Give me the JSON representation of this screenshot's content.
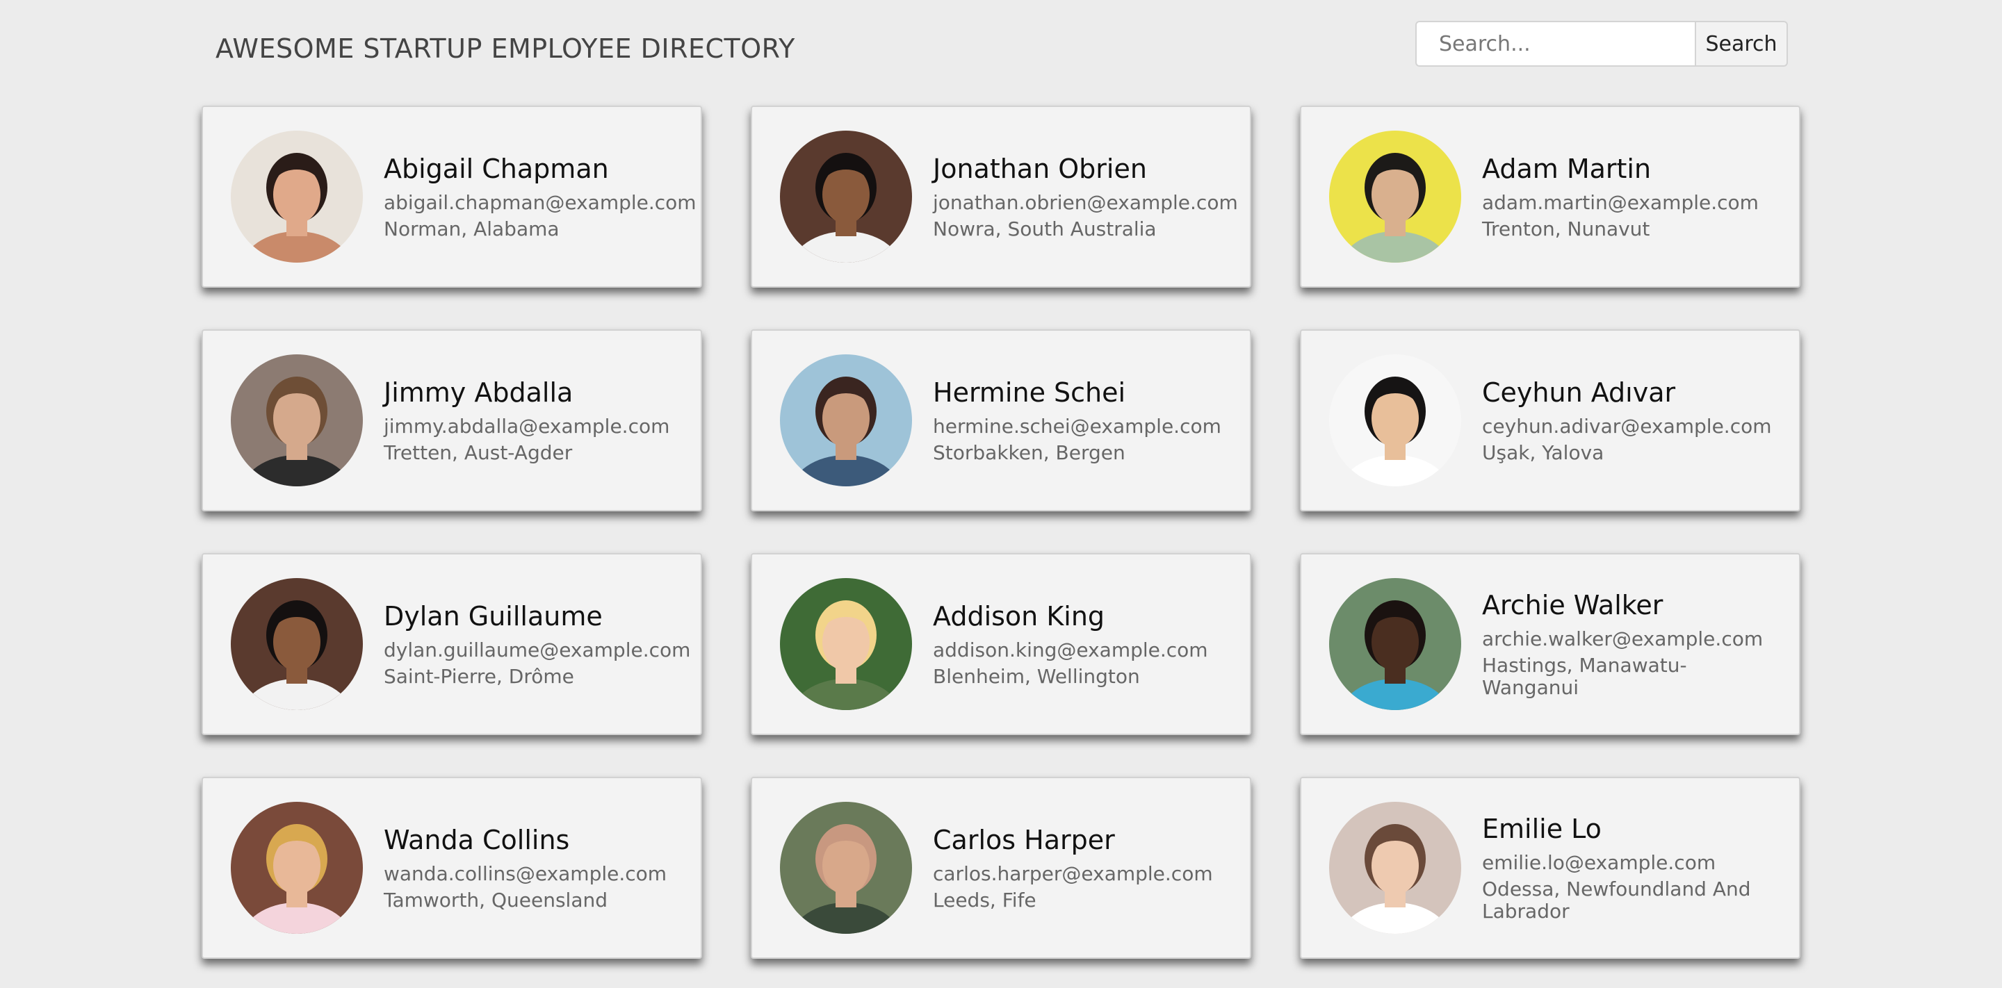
{
  "header": {
    "title": "AWESOME STARTUP EMPLOYEE DIRECTORY",
    "search_placeholder": "Search...",
    "search_button_label": "Search"
  },
  "employees": [
    {
      "name": "Abigail Chapman",
      "email": "abigail.chapman@example.com",
      "location": "Norman, Alabama",
      "avatar_bg": "#e8e2da",
      "skin": "#e0a98a",
      "hair": "#2a1c18",
      "shirt": "#c98a6a"
    },
    {
      "name": "Jonathan Obrien",
      "email": "jonathan.obrien@example.com",
      "location": "Nowra, South Australia",
      "avatar_bg": "#5a3a2e",
      "skin": "#8a5a3c",
      "hair": "#141010",
      "shirt": "#f2f2f2"
    },
    {
      "name": "Adam Martin",
      "email": "adam.martin@example.com",
      "location": "Trenton, Nunavut",
      "avatar_bg": "#ece24a",
      "skin": "#d9b08e",
      "hair": "#1c1a18",
      "shirt": "#a9c4a4"
    },
    {
      "name": "Jimmy Abdalla",
      "email": "jimmy.abdalla@example.com",
      "location": "Tretten, Aust-Agder",
      "avatar_bg": "#8c7b72",
      "skin": "#d5a98c",
      "hair": "#6e4e36",
      "shirt": "#2c2c2c"
    },
    {
      "name": "Hermine Schei",
      "email": "hermine.schei@example.com",
      "location": "Storbakken, Bergen",
      "avatar_bg": "#9ec3d8",
      "skin": "#c99a7c",
      "hair": "#3a2520",
      "shirt": "#3c5a7a"
    },
    {
      "name": "Ceyhun Adıvar",
      "email": "ceyhun.adivar@example.com",
      "location": "Uşak, Yalova",
      "avatar_bg": "#f7f7f7",
      "skin": "#e8bf9a",
      "hair": "#161414",
      "shirt": "#ffffff"
    },
    {
      "name": "Dylan Guillaume",
      "email": "dylan.guillaume@example.com",
      "location": "Saint-Pierre, Drôme",
      "avatar_bg": "#5a3a2e",
      "skin": "#8a5a3c",
      "hair": "#141010",
      "shirt": "#f2f2f2"
    },
    {
      "name": "Addison King",
      "email": "addison.king@example.com",
      "location": "Blenheim, Wellington",
      "avatar_bg": "#3f6b36",
      "skin": "#f0c8a8",
      "hair": "#f2d48a",
      "shirt": "#5a7a4a"
    },
    {
      "name": "Archie Walker",
      "email": "archie.walker@example.com",
      "location": "Hastings, Manawatu-Wanganui",
      "avatar_bg": "#6c8c6a",
      "skin": "#4a2e20",
      "hair": "#1a1210",
      "shirt": "#3aaad0"
    },
    {
      "name": "Wanda Collins",
      "email": "wanda.collins@example.com",
      "location": "Tamworth, Queensland",
      "avatar_bg": "#7a4a3a",
      "skin": "#e8b898",
      "hair": "#d8a850",
      "shirt": "#f4d4dc"
    },
    {
      "name": "Carlos Harper",
      "email": "carlos.harper@example.com",
      "location": "Leeds, Fife",
      "avatar_bg": "#6a7a5a",
      "skin": "#d8a88a",
      "hair": "#c89880",
      "shirt": "#3a4a3a"
    },
    {
      "name": "Emilie Lo",
      "email": "emilie.lo@example.com",
      "location": "Odessa, Newfoundland And Labrador",
      "avatar_bg": "#d4c4bc",
      "skin": "#eecab0",
      "hair": "#6a4a3a",
      "shirt": "#ffffff"
    }
  ]
}
